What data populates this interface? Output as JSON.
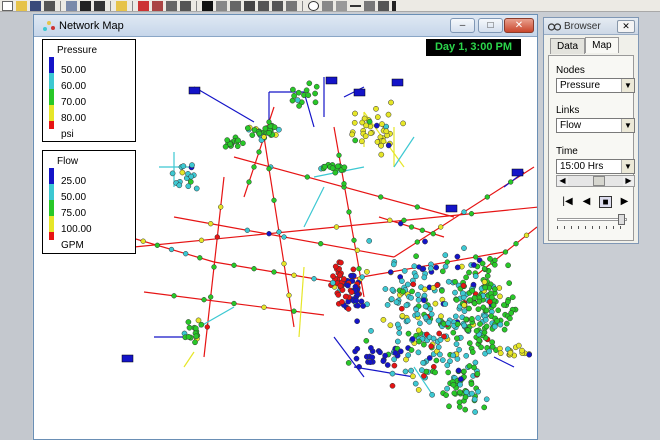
{
  "map_window": {
    "title": "Network Map",
    "time_display": "Day 1, 3:00 PM",
    "buttons": {
      "minimize": "–",
      "maximize": "□",
      "close": "✕"
    }
  },
  "pressure_legend": {
    "title": "Pressure",
    "unit": "psi",
    "entries": [
      {
        "label": "50.00",
        "color": "#1414c8"
      },
      {
        "label": "60.00",
        "color": "#3cc8d2"
      },
      {
        "label": "70.00",
        "color": "#28c828"
      },
      {
        "label": "80.00",
        "color": "#e6e628"
      }
    ],
    "top_color": "#e61414"
  },
  "flow_legend": {
    "title": "Flow",
    "unit": "GPM",
    "entries": [
      {
        "label": "25.00",
        "color": "#1414c8"
      },
      {
        "label": "50.00",
        "color": "#3cc8d2"
      },
      {
        "label": "75.00",
        "color": "#28c828"
      },
      {
        "label": "100.00",
        "color": "#e6e628"
      }
    ],
    "top_color": "#e61414"
  },
  "browser": {
    "title": "Browser",
    "close": "✕",
    "tabs": [
      {
        "label": "Data",
        "active": false
      },
      {
        "label": "Map",
        "active": true
      }
    ],
    "nodes_label": "Nodes",
    "nodes_value": "Pressure",
    "links_label": "Links",
    "links_value": "Flow",
    "time_label": "Time",
    "time_value": "15:00 Hrs",
    "controls": {
      "rewind": "|◀",
      "back": "◀",
      "stop": "■",
      "forward": "▶"
    }
  },
  "colors": {
    "low": "#1414c8",
    "mid_low": "#3cc8d2",
    "mid": "#28c828",
    "mid_high": "#e6e628",
    "high": "#e61414"
  }
}
